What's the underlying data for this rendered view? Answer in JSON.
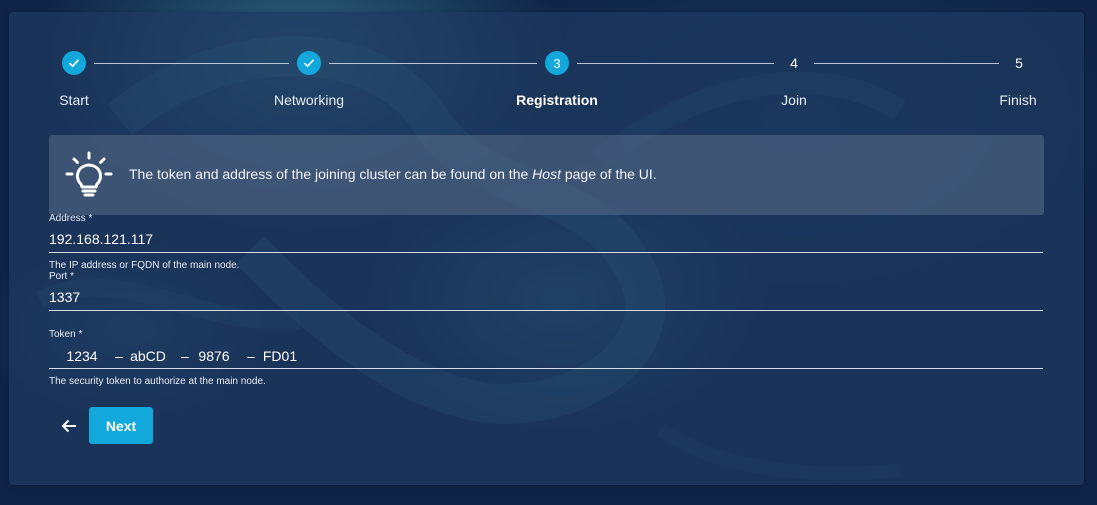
{
  "stepper": {
    "steps": [
      {
        "number": "",
        "label": "Start",
        "state": "done"
      },
      {
        "number": "",
        "label": "Networking",
        "state": "done"
      },
      {
        "number": "3",
        "label": "Registration",
        "state": "active"
      },
      {
        "number": "4",
        "label": "Join",
        "state": "pending"
      },
      {
        "number": "5",
        "label": "Finish",
        "state": "pending"
      }
    ]
  },
  "info": {
    "icon": "lightbulb-icon",
    "text_before": "The token and address of the joining cluster can be found on the ",
    "text_emphasis": "Host",
    "text_after": " page of the UI."
  },
  "form": {
    "address": {
      "label": "Address *",
      "value": "192.168.121.117",
      "hint": "The IP address or FQDN of the main node."
    },
    "port": {
      "label": "Port *",
      "value": "1337"
    },
    "token": {
      "label": "Token *",
      "parts": [
        "1234",
        "abCD",
        "9876",
        "FD01"
      ],
      "separator": "–",
      "hint": "The security token to authorize at the main node."
    }
  },
  "actions": {
    "back_icon": "arrow-left-icon",
    "next_label": "Next"
  },
  "colors": {
    "accent": "#12a8dc",
    "panel": "#1f395f",
    "background": "#0f2447"
  }
}
